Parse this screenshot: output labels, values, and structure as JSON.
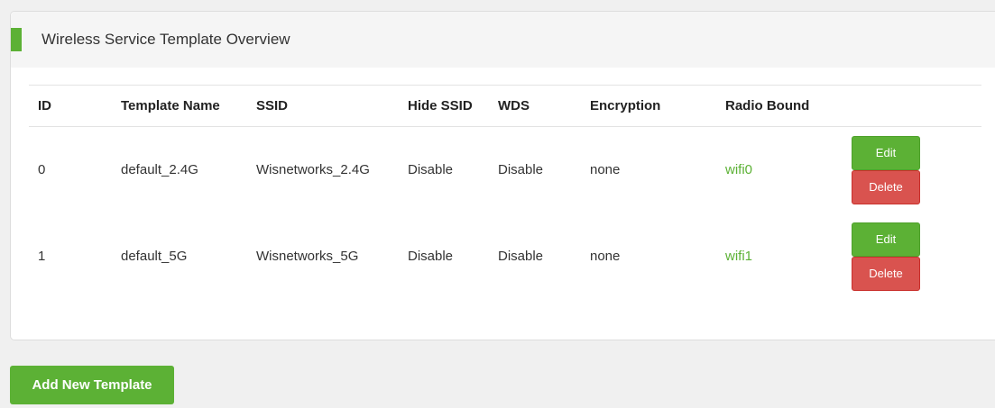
{
  "panel": {
    "title": "Wireless Service Template Overview"
  },
  "table": {
    "headers": {
      "id": "ID",
      "template_name": "Template Name",
      "ssid": "SSID",
      "hide_ssid": "Hide SSID",
      "wds": "WDS",
      "encryption": "Encryption",
      "radio_bound": "Radio Bound"
    },
    "rows": [
      {
        "id": "0",
        "template_name": "default_2.4G",
        "ssid": "Wisnetworks_2.4G",
        "hide_ssid": "Disable",
        "wds": "Disable",
        "encryption": "none",
        "radio_bound": "wifi0",
        "edit_label": "Edit",
        "delete_label": "Delete"
      },
      {
        "id": "1",
        "template_name": "default_5G",
        "ssid": "Wisnetworks_5G",
        "hide_ssid": "Disable",
        "wds": "Disable",
        "encryption": "none",
        "radio_bound": "wifi1",
        "edit_label": "Edit",
        "delete_label": "Delete"
      }
    ]
  },
  "actions": {
    "add_template_label": "Add New Template"
  },
  "colors": {
    "accent": "#5cb135",
    "danger": "#d9534f",
    "header_bg": "#f5f5f5",
    "page_bg": "#f0f0f0"
  }
}
